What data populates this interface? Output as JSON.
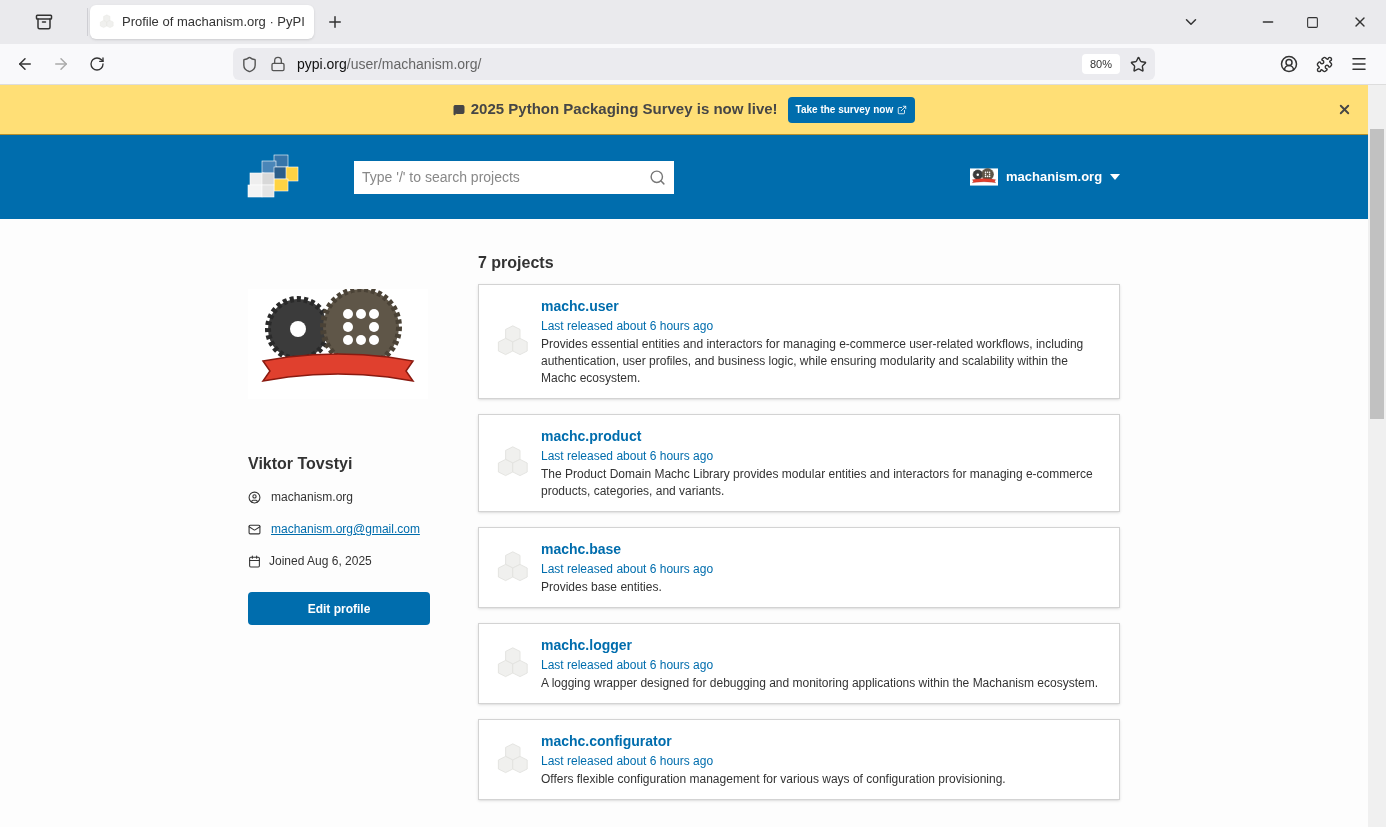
{
  "browser": {
    "tab_title": "Profile of machanism.org · PyPI",
    "url_host": "pypi.org",
    "url_path": "/user/machanism.org/",
    "zoom": "80%"
  },
  "banner": {
    "text": "2025 Python Packaging Survey is now live!",
    "button": "Take the survey now"
  },
  "header": {
    "search_placeholder": "Type '/' to search projects",
    "user": "machanism.org"
  },
  "profile": {
    "name": "Viktor Tovstyi",
    "username": "machanism.org",
    "email": "machanism.org@gmail.com",
    "joined": "Joined Aug 6, 2025",
    "edit_button": "Edit profile"
  },
  "projects_heading": "7 projects",
  "projects": [
    {
      "name": "machc.user",
      "released": "Last released about 6 hours ago",
      "description": "Provides essential entities and interactors for managing e-commerce user-related workflows, including authentication, user profiles, and business logic, while ensuring modularity and scalability within the Machc ecosystem."
    },
    {
      "name": "machc.product",
      "released": "Last released about 6 hours ago",
      "description": "The Product Domain Machc Library provides modular entities and interactors for managing e-commerce products, categories, and variants."
    },
    {
      "name": "machc.base",
      "released": "Last released about 6 hours ago",
      "description": "Provides base entities."
    },
    {
      "name": "machc.logger",
      "released": "Last released about 6 hours ago",
      "description": "A logging wrapper designed for debugging and monitoring applications within the Machanism ecosystem."
    },
    {
      "name": "machc.configurator",
      "released": "Last released about 6 hours ago",
      "description": "Offers flexible configuration management for various ways of configuration provisioning."
    }
  ]
}
